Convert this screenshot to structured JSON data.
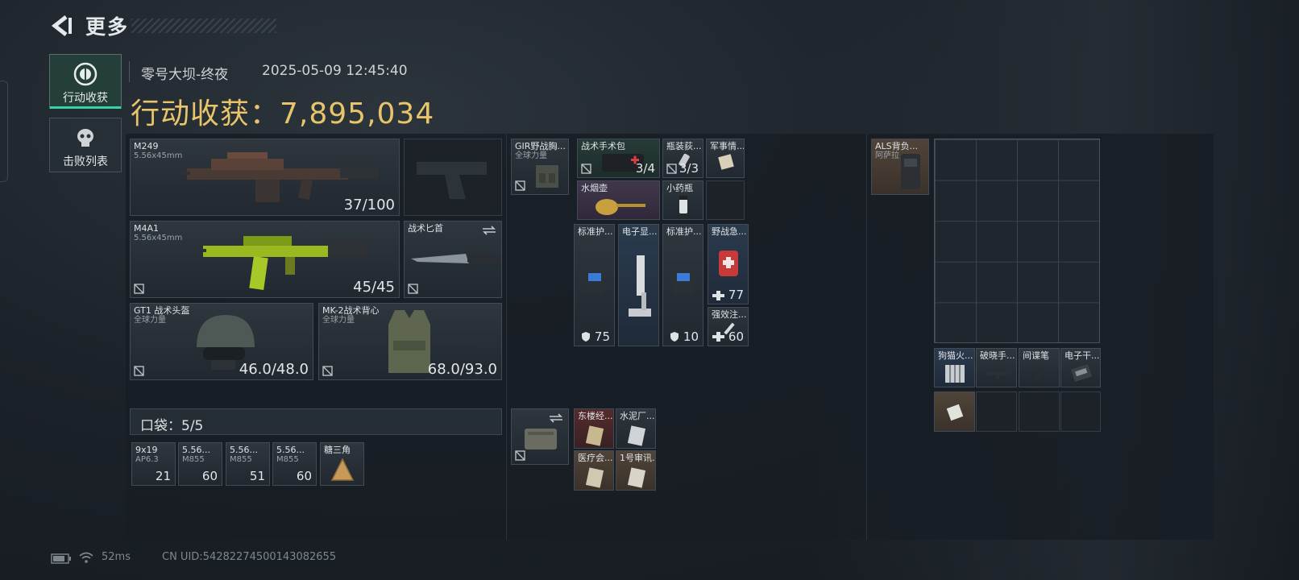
{
  "header": {
    "title": "更多"
  },
  "sidebar": {
    "tabs": [
      {
        "label": "行动收获",
        "active": true
      },
      {
        "label": "击败列表",
        "active": false
      }
    ]
  },
  "match": {
    "map": "零号大坝-终夜",
    "datetime": "2025-05-09 12:45:40",
    "loot_label": "行动收获：",
    "loot_value": "7,895,034"
  },
  "loadout": {
    "primary": {
      "name": "M249",
      "caliber": "5.56x45mm",
      "ammo": "37/100"
    },
    "secondary": {
      "name": "M4A1",
      "caliber": "5.56x45mm",
      "ammo": "45/45"
    },
    "melee": {
      "name": "战术匕首"
    },
    "helmet": {
      "name": "GT1 战术头盔",
      "source": "全球力量",
      "durability": "46.0/48.0"
    },
    "armor": {
      "name": "MK-2战术背心",
      "source": "全球力量",
      "durability": "68.0/93.0"
    }
  },
  "pockets": {
    "label": "口袋：5/5",
    "items": [
      {
        "name": "9x19",
        "sub": "AP6.3",
        "count": "21",
        "tint": "gray"
      },
      {
        "name": "5.56...",
        "sub": "M855",
        "count": "60",
        "tint": "gray"
      },
      {
        "name": "5.56...",
        "sub": "M855",
        "count": "51",
        "tint": "gray"
      },
      {
        "name": "5.56...",
        "sub": "M855",
        "count": "60",
        "tint": "gray"
      },
      {
        "name": "糖三角",
        "sub": "",
        "count": "",
        "tint": "gray"
      }
    ]
  },
  "chest_rig": {
    "name": "GIR野战胸...",
    "source": "全球力量",
    "items": [
      {
        "name": "战术手术包",
        "count": "3/4",
        "tint": "green"
      },
      {
        "name": "瓶装荻...",
        "count": "3/3",
        "tint": "gray"
      },
      {
        "name": "军事情...",
        "count": "",
        "tint": "gray"
      },
      {
        "name": "水烟壶",
        "count": "",
        "tint": "purple"
      },
      {
        "name": "小药瓶",
        "count": "",
        "tint": "gray"
      },
      {
        "name": "标准护...",
        "count": "75",
        "tint": "gray"
      },
      {
        "name": "电子显...",
        "count": "",
        "tint": "blue"
      },
      {
        "name": "标准护...",
        "count": "10",
        "tint": "gray"
      },
      {
        "name": "野战急...",
        "count": "77",
        "tint": "blue"
      },
      {
        "name": "强效注...",
        "count": "60",
        "tint": "gray"
      }
    ]
  },
  "case": {
    "items": [
      {
        "name": "东楼经...",
        "tint": "red"
      },
      {
        "name": "水泥厂...",
        "tint": "gray"
      },
      {
        "name": "医疗会...",
        "tint": "brown"
      },
      {
        "name": "1号审讯...",
        "tint": "brown"
      }
    ]
  },
  "backpack": {
    "name": "ALS背负...",
    "source": "阿萨拉",
    "items": [
      {
        "name": "狗猫火...",
        "tint": "blue"
      },
      {
        "name": "破晓手...",
        "tint": "gray"
      },
      {
        "name": "间谍笔",
        "tint": "gray"
      },
      {
        "name": "电子干...",
        "tint": "gray"
      }
    ]
  },
  "footer": {
    "ping": "52ms",
    "uid": "CN UID:54282274500143082655"
  }
}
